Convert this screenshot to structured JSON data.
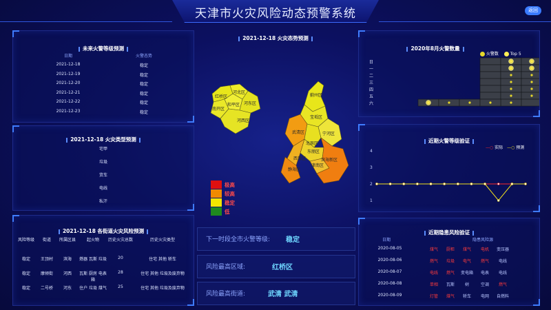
{
  "app_title": "天津市火灾风险动态预警系统",
  "header_button": "返回",
  "forecast": {
    "title": "未来火警等级预测",
    "col_date": "日期",
    "col_status": "火警态势",
    "rows": [
      {
        "date": "2021-12-18",
        "status": "稳定"
      },
      {
        "date": "2021-12-19",
        "status": "稳定"
      },
      {
        "date": "2021-12-20",
        "status": "稳定"
      },
      {
        "date": "2021-12-21",
        "status": "稳定"
      },
      {
        "date": "2021-12-22",
        "status": "稳定"
      },
      {
        "date": "2021-12-23",
        "status": "稳定"
      }
    ]
  },
  "fire_type": {
    "title": "2021-12-18 火灾类型预测",
    "items": [
      "宅甲",
      "垃圾",
      "货车",
      "电线",
      "私汗"
    ]
  },
  "street_risk": {
    "title": "2021-12-18 各街道火灾风险预测",
    "headers": [
      "风险等级",
      "街道",
      "所属区县",
      "起火物",
      "历史火灾总数",
      "历史火灾类型"
    ],
    "rows": [
      [
        "稳定",
        "王顶村",
        "滨海",
        "燃器 瓦斯 垃圾",
        "20",
        "住宅 其他 轿车"
      ],
      [
        "稳定",
        "摩倾街",
        "河西",
        "瓦斯 厨房 电表箱",
        "28",
        "住宅 其他 垃圾及废弃物"
      ],
      [
        "稳定",
        "二号桥",
        "河东",
        "住户 垃圾 煤气",
        "25",
        "住宅 其他 垃圾及废弃物"
      ]
    ]
  },
  "map": {
    "title": "2021-12-18 火灾态势预测",
    "districts": [
      "红桥区",
      "河北区",
      "南开区",
      "和平区",
      "河东区",
      "河西区",
      "蓟州区",
      "宝坻区",
      "宁河区",
      "武清区",
      "北辰区",
      "东丽区",
      "西青区",
      "津南区",
      "静海区",
      "滨海新区"
    ],
    "legend": [
      {
        "label": "极高",
        "color": "#e01010"
      },
      {
        "label": "较高",
        "color": "#f08a00"
      },
      {
        "label": "稳定",
        "color": "#f2e600"
      },
      {
        "label": "低",
        "color": "#1f8a1f"
      }
    ]
  },
  "info": {
    "next_level_label": "下一时段全市火警等级:",
    "next_level_value": "稳定",
    "top_district_label": "风险最高区域:",
    "top_district_value": "红桥区",
    "top_street_label": "风险最高街道:",
    "top_street_value": "武清 武清"
  },
  "august": {
    "title": "2020年8月火警数量",
    "legend": [
      "火警数",
      "Top 5"
    ],
    "weekdays": [
      "日",
      "一",
      "二",
      "三",
      "四",
      "五",
      "六"
    ]
  },
  "validation": {
    "title": "近期火警等级验证",
    "legend": [
      "实际",
      "预测"
    ]
  },
  "hazard": {
    "title": "近期隐患风险验证",
    "col_date": "日期",
    "col_hazard": "隐患风险源",
    "rows": [
      {
        "date": "2020-08-05",
        "items": [
          [
            "煤气",
            "r"
          ],
          [
            "厨柜",
            "r"
          ],
          [
            "煤气",
            "r"
          ],
          [
            "电机",
            "r"
          ],
          [
            "变压器",
            "b"
          ]
        ]
      },
      {
        "date": "2020-08-06",
        "items": [
          [
            "燃气",
            "r"
          ],
          [
            "垃圾",
            "r"
          ],
          [
            "电气",
            "r"
          ],
          [
            "燃气",
            "r"
          ],
          [
            "电线",
            "b"
          ]
        ]
      },
      {
        "date": "2020-08-07",
        "items": [
          [
            "电线",
            "r"
          ],
          [
            "燃气",
            "r"
          ],
          [
            "变电箱",
            "b"
          ],
          [
            "电表",
            "b"
          ],
          [
            "电线",
            "b"
          ]
        ]
      },
      {
        "date": "2020-08-08",
        "items": [
          [
            "单相",
            "r"
          ],
          [
            "瓦斯",
            "b"
          ],
          [
            "树",
            "b"
          ],
          [
            "空调",
            "b"
          ],
          [
            "燃气",
            "r"
          ]
        ]
      },
      {
        "date": "2020-08-09",
        "items": [
          [
            "灯管",
            "r"
          ],
          [
            "煤气",
            "r"
          ],
          [
            "轿车",
            "b"
          ],
          [
            "电网",
            "b"
          ],
          [
            "自燃料",
            "b"
          ]
        ]
      }
    ]
  },
  "chart_data": [
    {
      "type": "line",
      "title": "近期火警等级验证",
      "x": [
        1,
        2,
        3,
        4,
        5,
        6,
        7,
        8,
        9,
        10,
        11,
        12
      ],
      "ylim": [
        1,
        4
      ],
      "yticks": [
        1,
        2,
        3,
        4
      ],
      "series": [
        {
          "name": "实际",
          "color": "#ff2a2a",
          "values": [
            2,
            2,
            2,
            2,
            2,
            2,
            2,
            2,
            2,
            2,
            2,
            2
          ]
        },
        {
          "name": "预测",
          "color": "#f4e21c",
          "values": [
            2,
            2,
            2,
            2,
            2,
            2,
            2,
            2,
            2,
            1,
            2,
            2
          ]
        }
      ]
    },
    {
      "type": "scatter",
      "title": "2020年8月火警数量",
      "series": [
        {
          "name": "火警数",
          "color": "#e6d82a",
          "points": [
            [
              5,
              0
            ],
            [
              5,
              1
            ],
            [
              5,
              2
            ],
            [
              5,
              3
            ],
            [
              5,
              4
            ],
            [
              5,
              5
            ],
            [
              6,
              0
            ],
            [
              6,
              1
            ],
            [
              6,
              2
            ],
            [
              6,
              3
            ],
            [
              6,
              4
            ],
            [
              6,
              5
            ],
            [
              1,
              6
            ],
            [
              2,
              6
            ],
            [
              3,
              6
            ],
            [
              4,
              6
            ],
            [
              5,
              6
            ]
          ]
        },
        {
          "name": "Top 5",
          "color": "#ffee55",
          "points": [
            [
              1,
              6
            ],
            [
              5,
              0
            ],
            [
              5,
              1
            ],
            [
              6,
              0
            ],
            [
              6,
              1
            ]
          ]
        }
      ]
    }
  ]
}
